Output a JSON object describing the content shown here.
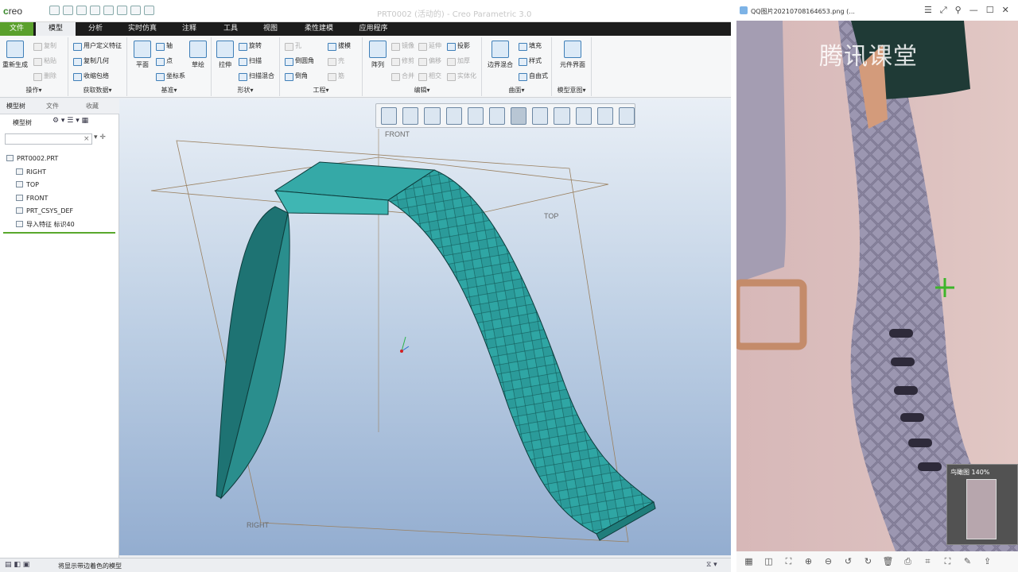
{
  "creo": {
    "logo": "creo",
    "title": "PRT0002 (活动的) - Creo Parametric 3.0",
    "menu": [
      "文件",
      "模型",
      "分析",
      "实时仿真",
      "注释",
      "工具",
      "视图",
      "柔性建模",
      "应用程序"
    ],
    "ribbon": {
      "operations": {
        "regen": "重新生成",
        "copy": "复制",
        "paste": "粘贴",
        "delete": "删除",
        "label": "操作▾"
      },
      "get_data": {
        "udf": "用户定义特征",
        "copy_geom": "复制几何",
        "shrinkwrap": "收缩包络",
        "label": "获取数据▾"
      },
      "datum": {
        "plane": "平面",
        "axis": "轴",
        "point": "点",
        "csys": "坐标系",
        "sketch": "草绘",
        "label": "基准▾"
      },
      "shapes": {
        "extrude": "拉伸",
        "revolve": "旋转",
        "sweep": "扫描",
        "swept_blend": "扫描混合",
        "label": "形状▾"
      },
      "engineering": {
        "hole": "孔",
        "round": "倒圆角",
        "chamfer": "倒角",
        "draft": "拔模",
        "shell": "壳",
        "rib": "筋",
        "label": "工程▾"
      },
      "editing": {
        "pattern": "阵列",
        "mirror": "镜像",
        "trim": "修剪",
        "merge": "合并",
        "extend": "延伸",
        "offset": "偏移",
        "intersect": "相交",
        "project": "投影",
        "thicken": "加厚",
        "solidify": "实体化",
        "label": "编辑▾"
      },
      "surfaces": {
        "boundary": "边界混合",
        "fill": "填充",
        "style": "样式",
        "freestyle": "自由式",
        "label": "曲面▾"
      },
      "intent": {
        "component": "元件界面",
        "label": "模型意图▾"
      }
    },
    "panel": {
      "tabs": [
        "模型树",
        "文件",
        "收藏"
      ],
      "header": "模型树",
      "tree": [
        "PRT0002.PRT",
        "RIGHT",
        "TOP",
        "FRONT",
        "PRT_CSYS_DEF",
        "导入特征 标识40"
      ]
    },
    "viewport": {
      "labels": {
        "front": "FRONT",
        "top": "TOP",
        "right": "RIGHT"
      }
    },
    "status": "将显示带边着色的模型"
  },
  "viewer": {
    "title": "QQ图片20210708164653.png (...",
    "watermark": "腾讯课堂",
    "navigator_label": "鸟瞰图 140%"
  }
}
